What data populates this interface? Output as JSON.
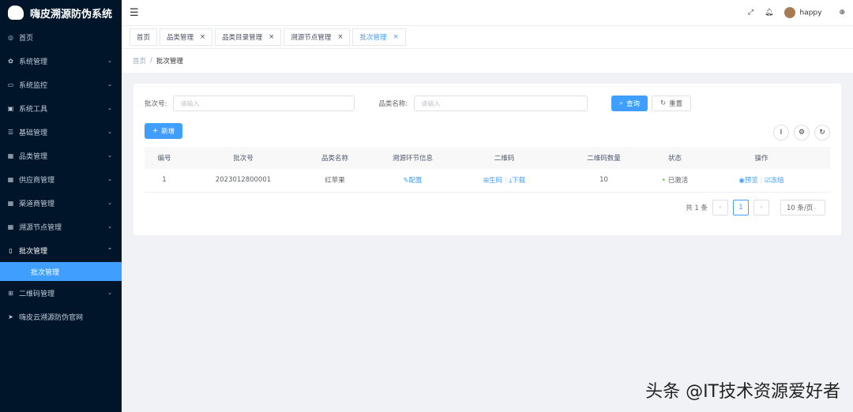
{
  "app": {
    "title": "嗨皮溯源防伪系统"
  },
  "sidebar": {
    "items": [
      {
        "label": "首页",
        "icon": "dashboard-icon"
      },
      {
        "label": "系统管理",
        "icon": "gear-icon"
      },
      {
        "label": "系统监控",
        "icon": "monitor-icon"
      },
      {
        "label": "系统工具",
        "icon": "tool-icon"
      },
      {
        "label": "基础管理",
        "icon": "sliders-icon"
      },
      {
        "label": "品类管理",
        "icon": "table-icon"
      },
      {
        "label": "供应商管理",
        "icon": "table-icon"
      },
      {
        "label": "渠道商管理",
        "icon": "table-icon"
      },
      {
        "label": "溯源节点管理",
        "icon": "table-icon"
      },
      {
        "label": "批次管理",
        "icon": "doc-icon"
      },
      {
        "label": "批次管理",
        "icon": ""
      },
      {
        "label": "二维码管理",
        "icon": "qrcode-icon"
      },
      {
        "label": "嗨皮云溯源防伪官网",
        "icon": "send-icon"
      }
    ]
  },
  "header": {
    "user": "happy"
  },
  "tabs": [
    {
      "label": "首页"
    },
    {
      "label": "品类管理"
    },
    {
      "label": "品类目录管理"
    },
    {
      "label": "溯源节点管理"
    },
    {
      "label": "批次管理"
    }
  ],
  "breadcrumb": {
    "home": "首页",
    "sep": "/",
    "current": "批次管理"
  },
  "search": {
    "batch_label": "批次号:",
    "batch_placeholder": "请输入",
    "name_label": "品类名称:",
    "name_placeholder": "请输入",
    "query": "查询",
    "reset": "重置"
  },
  "toolbar": {
    "add": "新增"
  },
  "table": {
    "headers": [
      "编号",
      "批次号",
      "品类名称",
      "溯源环节信息",
      "二维码",
      "二维码数量",
      "状态",
      "操作"
    ],
    "rows": [
      {
        "id": "1",
        "batch": "2023012800001",
        "name": "红苹果",
        "config": "配置",
        "gen": "生码",
        "download": "下载",
        "count": "10",
        "status": "已激活",
        "preview": "预览",
        "freeze": "冻结"
      }
    ]
  },
  "pager": {
    "total": "共 1 条",
    "page": "1",
    "size": "10 条/页"
  },
  "watermark": "头条 @IT技术资源爱好者"
}
